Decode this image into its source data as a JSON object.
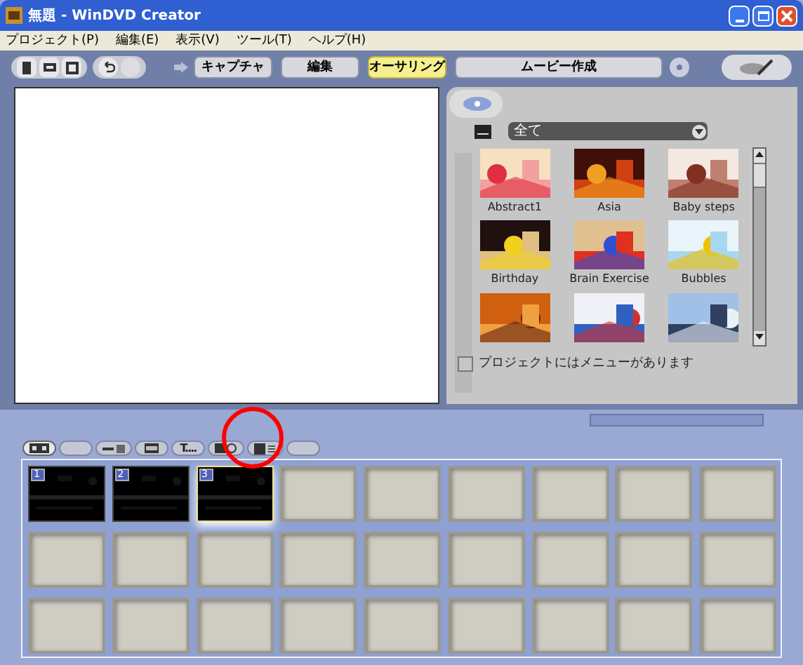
{
  "window": {
    "title": "無題 - WinDVD Creator"
  },
  "menu": [
    "プロジェクト(P)",
    "編集(E)",
    "表示(V)",
    "ツール(T)",
    "ヘルプ(H)"
  ],
  "steps": [
    {
      "label": "キャプチャ",
      "selected": false
    },
    {
      "label": "編集",
      "selected": false
    },
    {
      "label": "オーサリング",
      "selected": true
    },
    {
      "label": "ムービー作成",
      "selected": false
    }
  ],
  "menu_panel": {
    "filter": "全て",
    "templates": [
      {
        "kind": "picture",
        "label": "Abstract1"
      },
      {
        "kind": "picture",
        "label": "Asia"
      },
      {
        "kind": "picture",
        "label": "Baby steps"
      },
      {
        "kind": "picture",
        "label": "Birthday"
      },
      {
        "kind": "picture",
        "label": "Brain Exercise"
      },
      {
        "kind": "picture",
        "label": "Bubbles"
      },
      {
        "kind": "picture"
      },
      {
        "kind": "picture"
      },
      {
        "kind": "picture"
      }
    ],
    "has_menu": {
      "label": "プロジェクトにはメニューがあります",
      "checked": false
    }
  },
  "storyboard_tabs": [
    {
      "kind": "chapters",
      "selected": true
    },
    {
      "kind": "blank",
      "selected": false
    },
    {
      "kind": "split",
      "selected": false
    },
    {
      "kind": "film",
      "selected": false
    },
    {
      "kind": "text",
      "label": "T....",
      "selected": false
    },
    {
      "kind": "zoom",
      "selected": false
    },
    {
      "kind": "list",
      "selected": false
    },
    {
      "kind": "blank",
      "selected": false
    }
  ],
  "slots": [
    {
      "kind": "clip",
      "number": "1",
      "selected": false
    },
    {
      "kind": "clip",
      "number": "2",
      "selected": false
    },
    {
      "kind": "clip",
      "number": "3",
      "selected": true
    },
    {
      "kind": "empty"
    },
    {
      "kind": "empty"
    },
    {
      "kind": "empty"
    },
    {
      "kind": "empty"
    },
    {
      "kind": "empty"
    },
    {
      "kind": "empty"
    },
    {
      "kind": "empty"
    },
    {
      "kind": "empty"
    },
    {
      "kind": "empty"
    },
    {
      "kind": "empty"
    },
    {
      "kind": "empty"
    },
    {
      "kind": "empty"
    },
    {
      "kind": "empty"
    },
    {
      "kind": "empty"
    },
    {
      "kind": "empty"
    },
    {
      "kind": "empty"
    },
    {
      "kind": "empty"
    },
    {
      "kind": "empty"
    },
    {
      "kind": "empty"
    },
    {
      "kind": "empty"
    },
    {
      "kind": "empty"
    },
    {
      "kind": "empty"
    },
    {
      "kind": "empty"
    },
    {
      "kind": "empty"
    }
  ]
}
